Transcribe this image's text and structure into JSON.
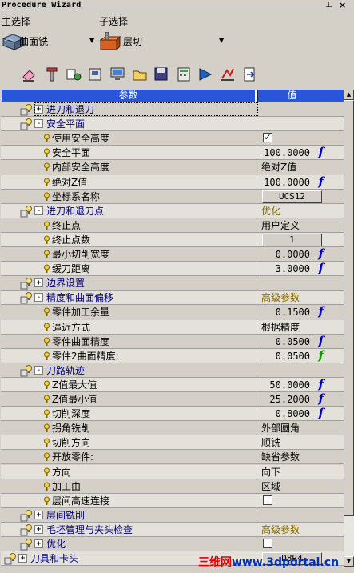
{
  "window": {
    "title": "Procedure Wizard",
    "pin_glyph": "⊥",
    "close_glyph": "×"
  },
  "main_select": {
    "label": "主选择",
    "value": "曲面铣",
    "icon": "surface-mill-icon"
  },
  "sub_select": {
    "label": "子选择",
    "value": "层切",
    "icon": "layer-cut-icon"
  },
  "toolbar": [
    "eraser-icon",
    "tool-icon",
    "wizard-icon",
    "stock-icon",
    "display-icon",
    "open-icon",
    "save-icon",
    "calc-icon",
    "simulate-icon",
    "verify-icon",
    "export-icon"
  ],
  "grid": {
    "header": {
      "param": "参数",
      "value": "值"
    },
    "rows": [
      {
        "type": "group",
        "exp": "+",
        "label": "进刀和退刀",
        "value": "",
        "indent": 1
      },
      {
        "type": "group",
        "exp": "-",
        "label": "安全平面",
        "value": "",
        "indent": 1
      },
      {
        "type": "item",
        "label": "使用安全高度",
        "kind": "check",
        "value": "✓"
      },
      {
        "type": "item",
        "label": "安全平面",
        "kind": "num",
        "value": "100.0000",
        "fx": "f"
      },
      {
        "type": "item",
        "label": "内部安全高度",
        "kind": "text",
        "value": "绝对Z值"
      },
      {
        "type": "item",
        "label": "绝对Z值",
        "kind": "num",
        "value": "100.0000",
        "fx": "f"
      },
      {
        "type": "item",
        "label": "坐标系名称",
        "kind": "button",
        "value": "UCS12"
      },
      {
        "type": "group",
        "exp": "-",
        "label": "进刀和退刀点",
        "kind": "opt",
        "value": "优化",
        "indent": 1
      },
      {
        "type": "item",
        "label": "终止点",
        "kind": "text",
        "value": "用户定义"
      },
      {
        "type": "item",
        "label": "终止点数",
        "kind": "button",
        "value": "1"
      },
      {
        "type": "item",
        "label": "最小切削宽度",
        "kind": "num",
        "value": "0.0000",
        "fx": "f"
      },
      {
        "type": "item",
        "label": "缓刀距离",
        "kind": "num",
        "value": "3.0000",
        "fx": "f"
      },
      {
        "type": "group",
        "exp": "+",
        "label": "边界设置",
        "value": "",
        "indent": 1
      },
      {
        "type": "group",
        "exp": "-",
        "label": "精度和曲面偏移",
        "kind": "opt",
        "value": "高级参数",
        "indent": 1
      },
      {
        "type": "item",
        "label": "零件加工余量",
        "kind": "num",
        "value": "0.1500",
        "fx": "f"
      },
      {
        "type": "item",
        "label": "逼近方式",
        "kind": "text",
        "value": "根据精度"
      },
      {
        "type": "item",
        "label": "零件曲面精度",
        "kind": "num",
        "value": "0.0500",
        "fx": "f"
      },
      {
        "type": "item",
        "label": "零件2曲面精度:",
        "kind": "num",
        "value": "0.0500",
        "fx": "f",
        "fxg": true
      },
      {
        "type": "group",
        "exp": "-",
        "label": "刀路轨迹",
        "value": "",
        "indent": 1
      },
      {
        "type": "item",
        "label": "Z值最大值",
        "kind": "num",
        "value": "50.0000",
        "fx": "f"
      },
      {
        "type": "item",
        "label": "Z值最小值",
        "kind": "num",
        "value": "25.2000",
        "fx": "f"
      },
      {
        "type": "item",
        "label": "切削深度",
        "kind": "num",
        "value": "0.8000",
        "fx": "f"
      },
      {
        "type": "item",
        "label": "拐角铣削",
        "kind": "text",
        "value": "外部圆角"
      },
      {
        "type": "item",
        "label": "切削方向",
        "kind": "text",
        "value": "顺铣"
      },
      {
        "type": "item",
        "label": "开放零件:",
        "kind": "text",
        "value": "缺省参数"
      },
      {
        "type": "item",
        "label": "方向",
        "kind": "text",
        "value": "向下"
      },
      {
        "type": "item",
        "label": "加工由",
        "kind": "text",
        "value": "区域"
      },
      {
        "type": "item",
        "label": "层间高速连接",
        "kind": "check",
        "value": ""
      },
      {
        "type": "group",
        "exp": "+",
        "label": "层间铣削",
        "value": "",
        "indent": 1
      },
      {
        "type": "group",
        "exp": "+",
        "label": "毛坯管理与夹头检查",
        "kind": "opt",
        "value": "高级参数",
        "indent": 1
      },
      {
        "type": "group",
        "exp": "+",
        "label": "优化",
        "kind": "check",
        "value": "",
        "indent": 1
      },
      {
        "type": "group",
        "exp": "+",
        "label": "刀具和卡头",
        "kind": "button",
        "value": "D8R4",
        "indent": 0
      }
    ]
  },
  "watermark": {
    "part1": "三维网",
    "part2": "www.3dportal.cn"
  }
}
